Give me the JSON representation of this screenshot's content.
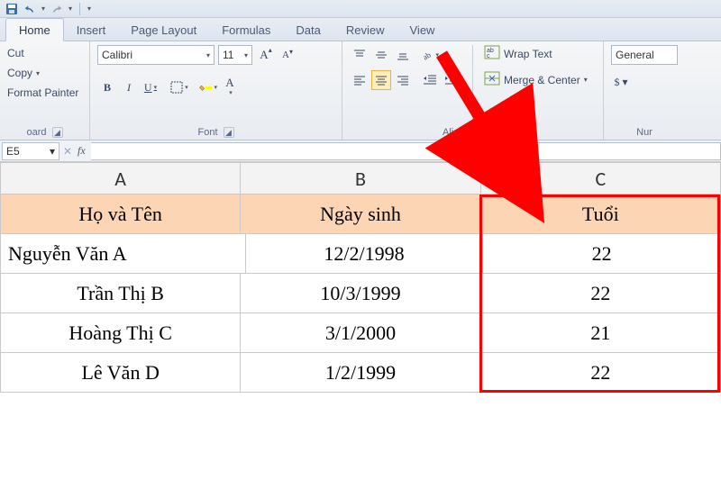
{
  "qat": {
    "customize_tip": "▾"
  },
  "tabs": {
    "home": "Home",
    "insert": "Insert",
    "page_layout": "Page Layout",
    "formulas": "Formulas",
    "data": "Data",
    "review": "Review",
    "view": "View"
  },
  "clipboard": {
    "cut": "Cut",
    "copy": "Copy",
    "format_painter": "Format Painter",
    "group_label": "oard"
  },
  "font": {
    "name": "Calibri",
    "size": "11",
    "group_label": "Font"
  },
  "alignment": {
    "wrap_text": "Wrap Text",
    "merge_center": "Merge & Center",
    "group_label": "Alignment"
  },
  "number": {
    "format": "General",
    "currency_prefix": "$",
    "group_label": "Nur"
  },
  "formula_bar": {
    "name_box": "E5",
    "fx_label": "fx",
    "value": ""
  },
  "columns": [
    "A",
    "B",
    "C"
  ],
  "header_row": {
    "a": "Họ và Tên",
    "b": "Ngày sinh",
    "c": "Tuổi"
  },
  "rows": [
    {
      "a": "Nguyễn Văn A",
      "b": "12/2/1998",
      "c": "22"
    },
    {
      "a": "Trần Thị B",
      "b": "10/3/1999",
      "c": "22"
    },
    {
      "a": "Hoàng Thị C",
      "b": "3/1/2000",
      "c": "21"
    },
    {
      "a": "Lê Văn D",
      "b": "1/2/1999",
      "c": "22"
    }
  ]
}
